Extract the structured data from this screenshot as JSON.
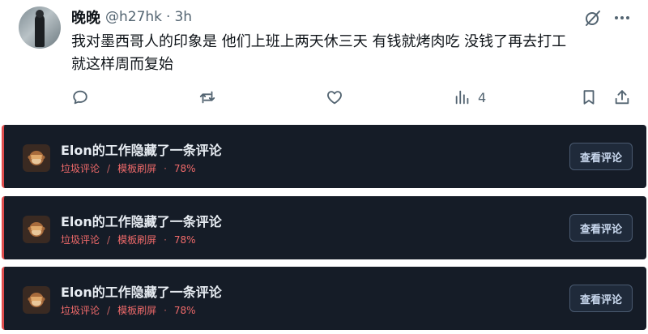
{
  "tweet": {
    "display_name": "晚晚",
    "handle": "@h27hk",
    "separator": "·",
    "time": "3h",
    "text_lines": [
      "我对墨西哥人的印象是 他们上班上两天休三天 有钱就烤肉吃 没钱了再去打工",
      "就这样周而复始"
    ],
    "views_count": "4"
  },
  "hidden_comments": [
    {
      "title": "Elon的工作隐藏了一条评论",
      "tag1": "垃圾评论",
      "slash": "/",
      "tag2": "模板刷屏",
      "dot": "·",
      "score": "78%",
      "button_label": "查看评论"
    },
    {
      "title": "Elon的工作隐藏了一条评论",
      "tag1": "垃圾评论",
      "slash": "/",
      "tag2": "模板刷屏",
      "dot": "·",
      "score": "78%",
      "button_label": "查看评论"
    },
    {
      "title": "Elon的工作隐藏了一条评论",
      "tag1": "垃圾评论",
      "slash": "/",
      "tag2": "模板刷屏",
      "dot": "·",
      "score": "78%",
      "button_label": "查看评论"
    }
  ],
  "colors": {
    "icon_gray": "#536471",
    "card_bg": "#151c27",
    "accent_red": "#e04e4e"
  },
  "icons": {
    "grok": "grok-icon",
    "more": "more-icon",
    "reply": "reply-icon",
    "retweet": "retweet-icon",
    "like": "like-icon",
    "views": "views-icon",
    "bookmark": "bookmark-icon",
    "share": "share-icon",
    "monkey": "see-no-evil-monkey-icon"
  }
}
